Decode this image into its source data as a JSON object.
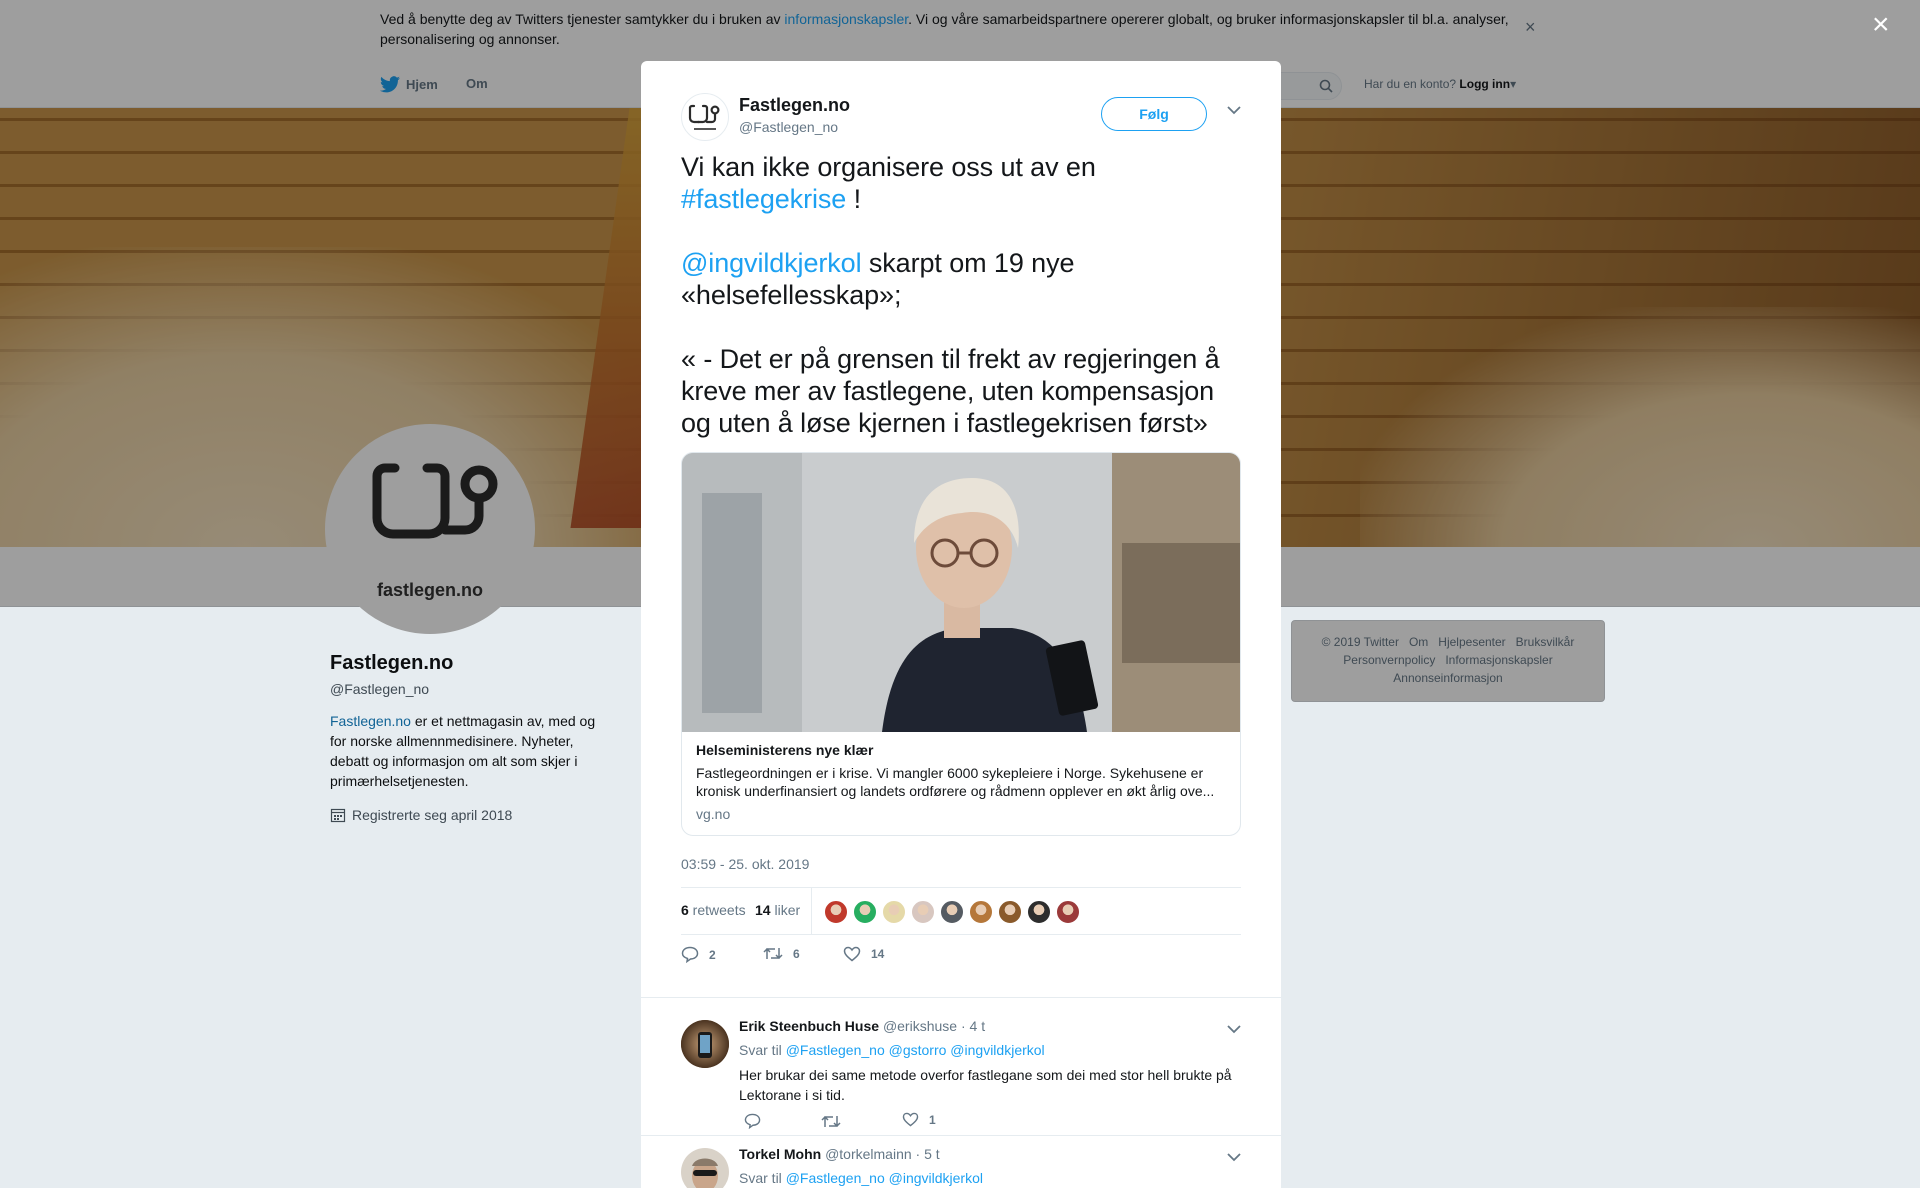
{
  "cookie_banner": {
    "text_before": "Ved å benytte deg av Twitters tjenester samtykker du i bruken av ",
    "link": "informasjonskapsler",
    "text_after": ". Vi og våre samarbeidspartnere opererer globalt, og bruker informasjonskapsler til bl.a. analyser, personalisering og annonser.",
    "close": "×"
  },
  "topnav": {
    "home": "Hjem",
    "about": "Om",
    "account_prompt": "Har du en konto?",
    "login": "Logg inn"
  },
  "profile": {
    "avatar_label": "fastlegen.no",
    "name": "Fastlegen.no",
    "handle": "@Fastlegen_no",
    "bio_link": "Fastlegen.no",
    "bio_rest": " er et nettmagasin av, med og for norske allmennmedisinere. Nyheter, debatt og informasjon om alt som skjer i primærhelsetjenesten.",
    "joined": "Registrerte seg april 2018"
  },
  "footer": {
    "row1": [
      "© 2019 Twitter",
      "Om",
      "Hjelpesenter",
      "Bruksvilkår"
    ],
    "row2": [
      "Personvernpolicy",
      "Informasjonskapsler"
    ],
    "row3": [
      "Annonseinformasjon"
    ]
  },
  "overlay_close": "×",
  "tweet": {
    "author_name": "Fastlegen.no",
    "author_handle": "@Fastlegen_no",
    "follow_label": "Følg",
    "line1": "Vi kan ikke organisere oss ut av en",
    "hashtag": "#fastlegekrise",
    "line2_end": " !",
    "mention": "@ingvildkjerkol",
    "line3_rest": " skarpt om 19 nye «helsefellesskap»;",
    "quote": "« - Det er på grensen til frekt av regjeringen å kreve mer av fastlegene, uten kompensasjon og uten å løse kjernen i fastlegekrisen først»",
    "card": {
      "title": "Helseministerens nye klær",
      "description": "Fastlegeordningen er i krise. Vi mangler 6000 sykepleiere i Norge. Sykehusene er kronisk underfinansiert og landets ordførere og rådmenn opplever en økt årlig ove...",
      "domain": "vg.no"
    },
    "timestamp": "03:59 - 25. okt. 2019",
    "retweets_count": "6",
    "retweets_label": " retweets",
    "likes_count": "14",
    "likes_label": " liker",
    "action_replies": "2",
    "action_retweets": "6",
    "action_likes": "14",
    "liker_avatar_colors": [
      "#c0392b",
      "#27ae60",
      "#e5d9a8",
      "#d8c7c0",
      "#555b62",
      "#b5773a",
      "#8a5a2b",
      "#2d2d2d",
      "#9b3a3a"
    ]
  },
  "replies": [
    {
      "name": "Erik Steenbuch Huse",
      "handle": "@erikshuse",
      "time": "· 4 t",
      "reply_to_label": "Svar til ",
      "reply_to": "@Fastlegen_no @gstorro @ingvildkjerkol",
      "text": "Her brukar dei same metode overfor fastlegane som dei med stor hell brukte på Lektorane i si tid.",
      "likes": "1",
      "avatar_color": "#7a5a3c"
    },
    {
      "name": "Torkel Mohn",
      "handle": "@torkelmainn",
      "time": "· 5 t",
      "reply_to_label": "Svar til ",
      "reply_to": "@Fastlegen_no @ingvildkjerkol",
      "avatar_color": "#b9a48e"
    }
  ]
}
